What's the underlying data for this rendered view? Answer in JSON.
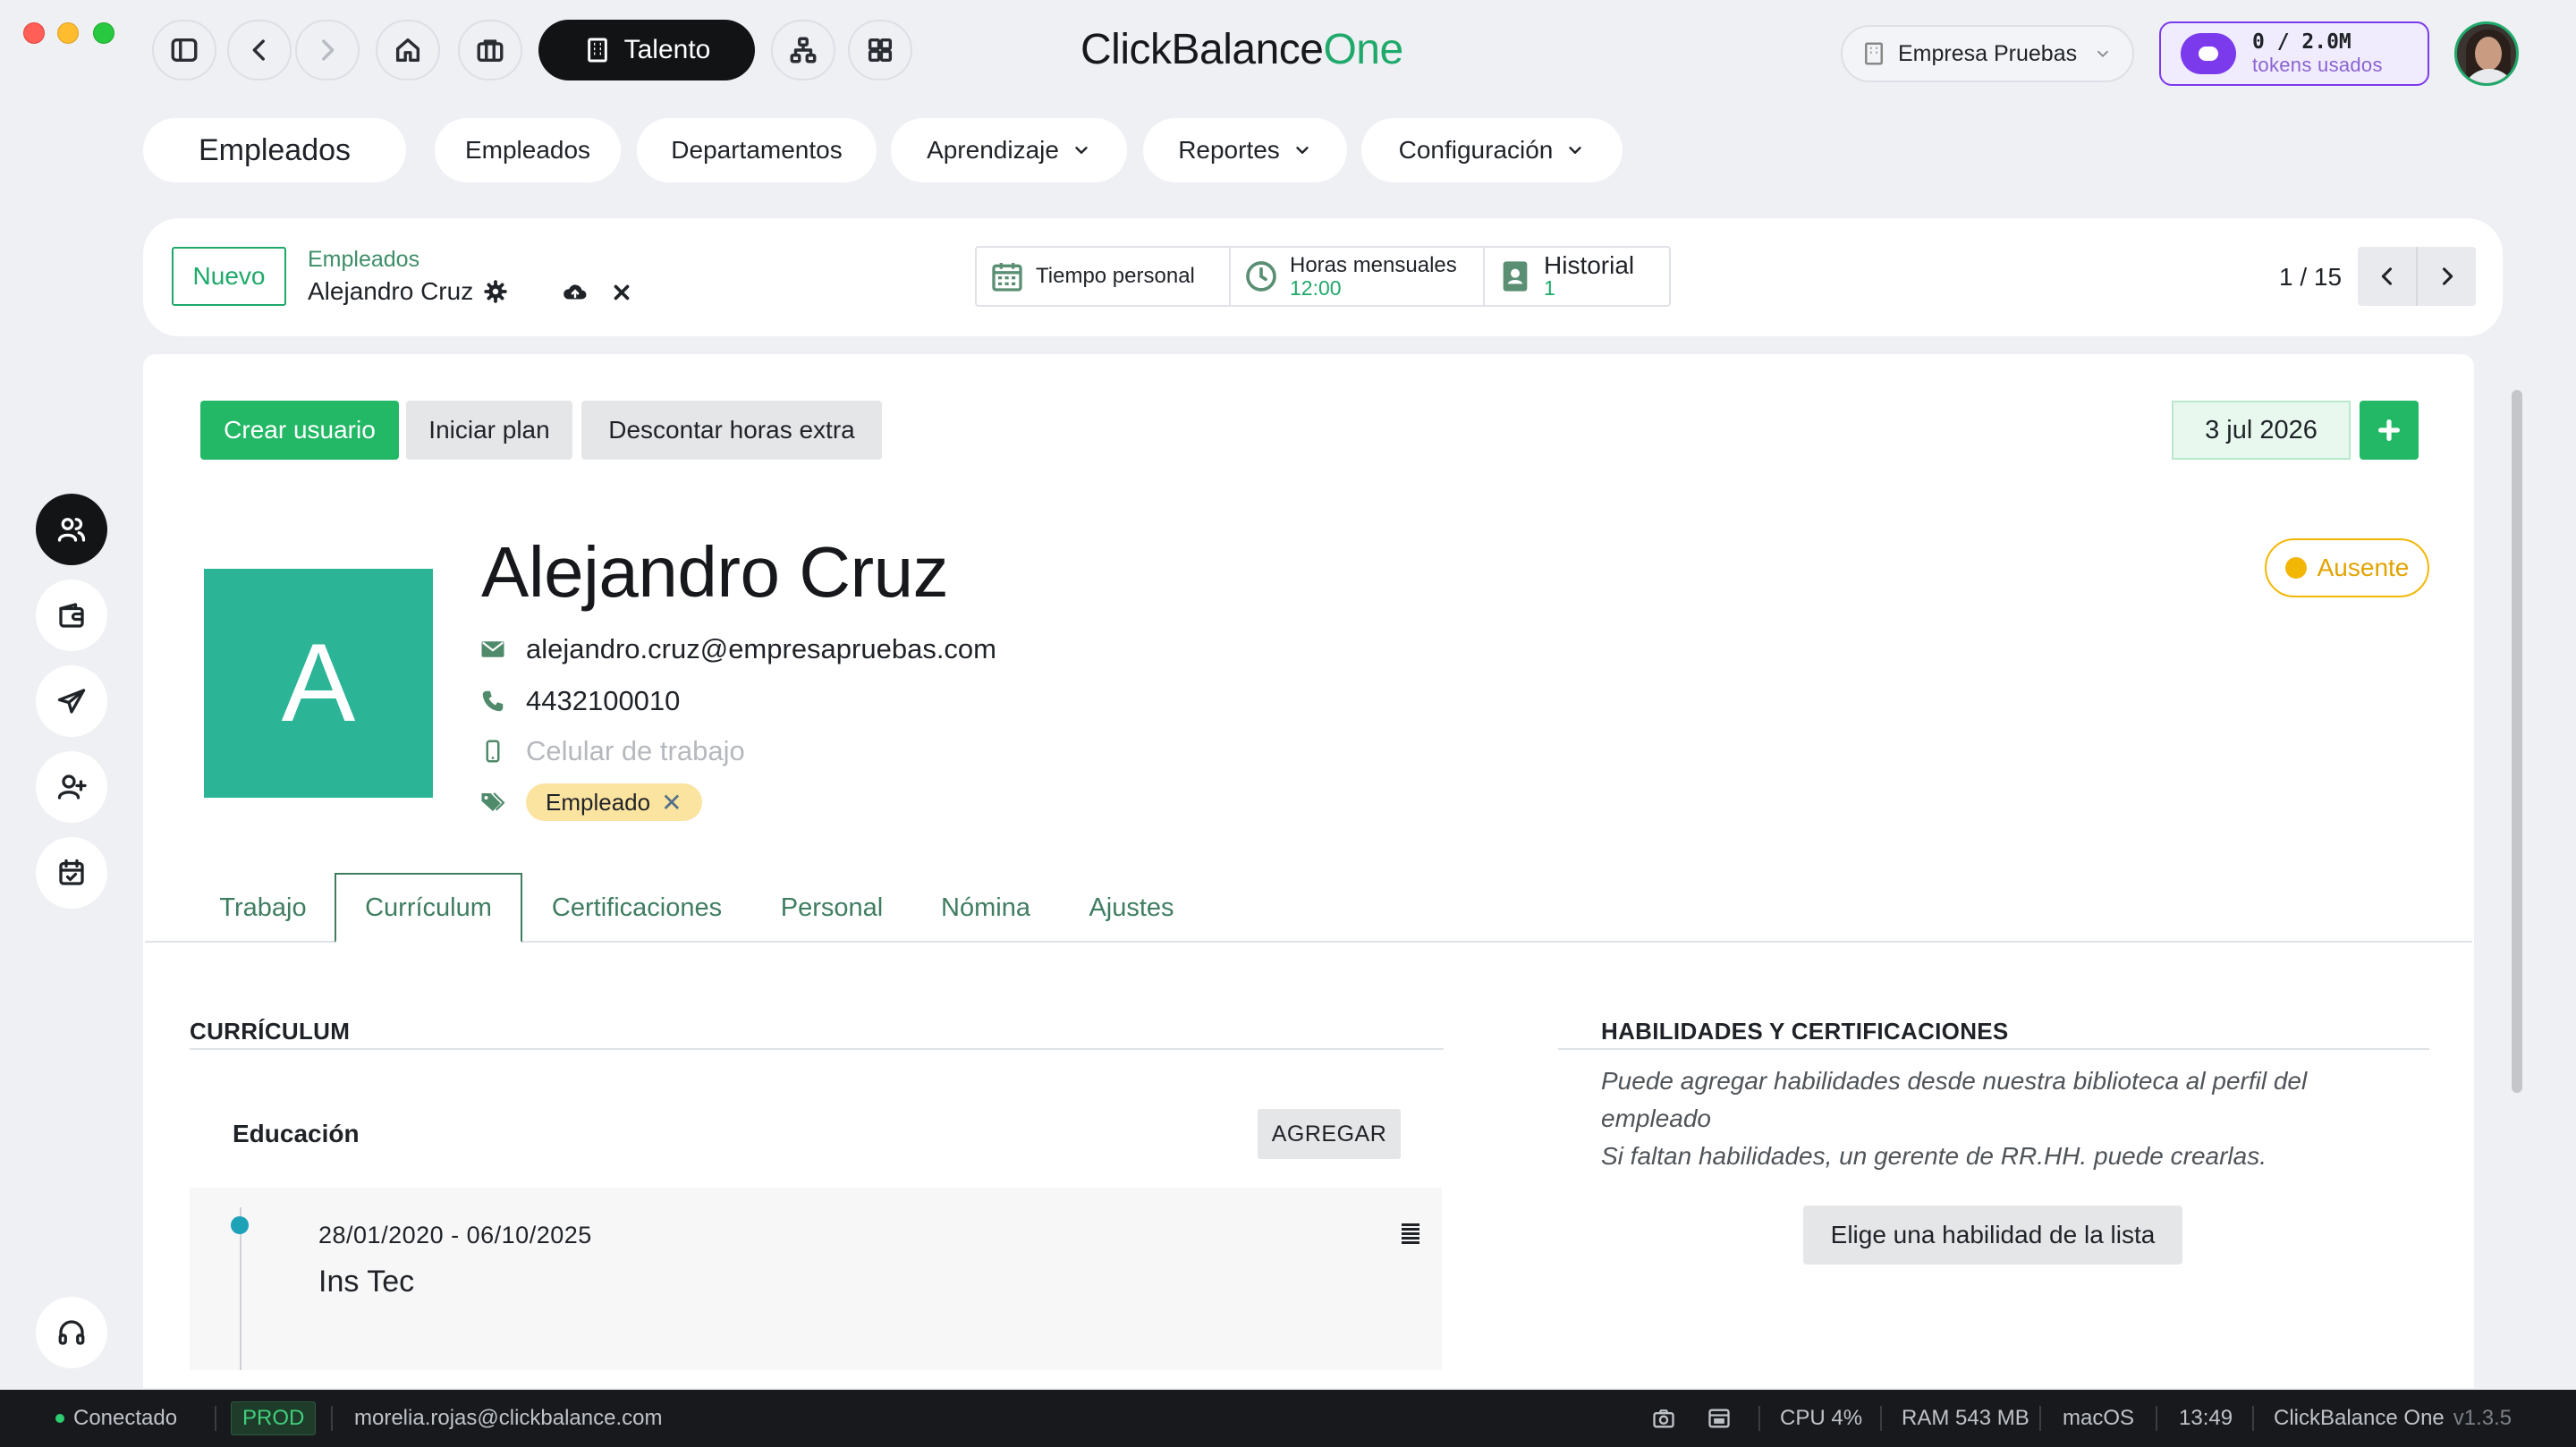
{
  "window": {
    "brand_prefix": "ClickBalance",
    "brand_suffix": "One",
    "active_app": "Talento",
    "company": "Empresa Pruebas",
    "tokens_value": "0 / 2.0M",
    "tokens_label": "tokens usados"
  },
  "nav": {
    "current": "Empleados",
    "items": [
      "Empleados",
      "Departamentos",
      "Aprendizaje",
      "Reportes",
      "Configuración"
    ]
  },
  "toolbar": {
    "new_label": "Nuevo",
    "breadcrumb_parent": "Empleados",
    "breadcrumb_current": "Alejandro Cruz",
    "smart_buttons": [
      {
        "title": "Tiempo personal",
        "sub": ""
      },
      {
        "title": "Horas mensuales",
        "sub": "12:00"
      },
      {
        "title": "Historial",
        "sub": "1"
      }
    ],
    "pager": "1 / 15"
  },
  "actions": {
    "create_user": "Crear usuario",
    "start_plan": "Iniciar plan",
    "discount_overtime": "Descontar horas extra",
    "date": "3 jul 2026"
  },
  "employee": {
    "initial": "A",
    "name": "Alejandro Cruz",
    "email": "alejandro.cruz@empresapruebas.com",
    "phone": "4432100010",
    "mobile_placeholder": "Celular de trabajo",
    "tag": "Empleado",
    "status": "Ausente",
    "colors": {
      "avatar": "#2bb596",
      "status": "#f2b705",
      "accent": "#22b865"
    }
  },
  "tabs": [
    "Trabajo",
    "Currículum",
    "Certificaciones",
    "Personal",
    "Nómina",
    "Ajustes"
  ],
  "active_tab": "Currículum",
  "resume": {
    "section_title": "CURRÍCULUM",
    "education_label": "Educación",
    "add_label": "AGREGAR",
    "entries": [
      {
        "dates": "28/01/2020 - 06/10/2025",
        "institution": "Ins Tec"
      }
    ]
  },
  "skills": {
    "section_title": "HABILIDADES Y CERTIFICACIONES",
    "help_line1": "Puede agregar habilidades desde nuestra biblioteca al perfil del empleado",
    "help_line2": "Si faltan habilidades, un gerente de RR.HH. puede crearlas.",
    "pick_button": "Elige una habilidad de la lista"
  },
  "statusbar": {
    "connection": "Conectado",
    "env": "PROD",
    "user": "morelia.rojas@clickbalance.com",
    "cpu": "CPU 4%",
    "ram": "RAM 543 MB",
    "os": "macOS",
    "time": "13:49",
    "app": "ClickBalance One",
    "version": "v1.3.5"
  }
}
